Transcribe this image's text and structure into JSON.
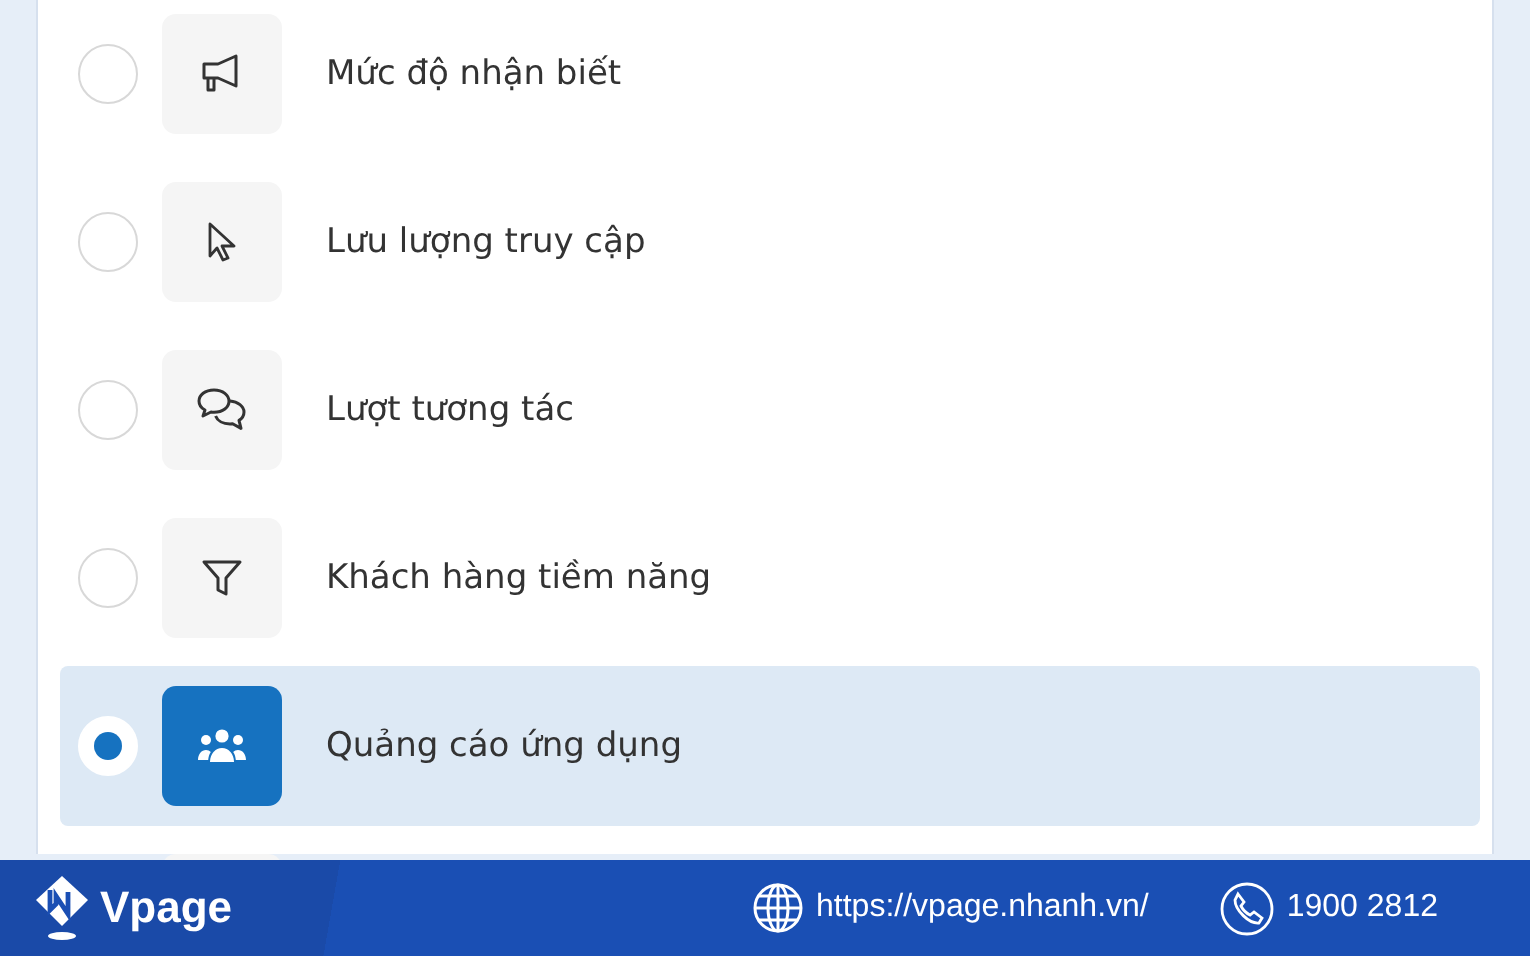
{
  "options": [
    {
      "label": "Mức độ nhận biết",
      "selected": false
    },
    {
      "label": "Lưu lượng truy cập",
      "selected": false
    },
    {
      "label": "Lượt tương tác",
      "selected": false
    },
    {
      "label": "Khách hàng tiềm năng",
      "selected": false
    },
    {
      "label": "Quảng cáo ứng dụng",
      "selected": true
    }
  ],
  "footer": {
    "brand": "Vpage",
    "website": "https://vpage.nhanh.vn/",
    "phone": "1900 2812"
  }
}
